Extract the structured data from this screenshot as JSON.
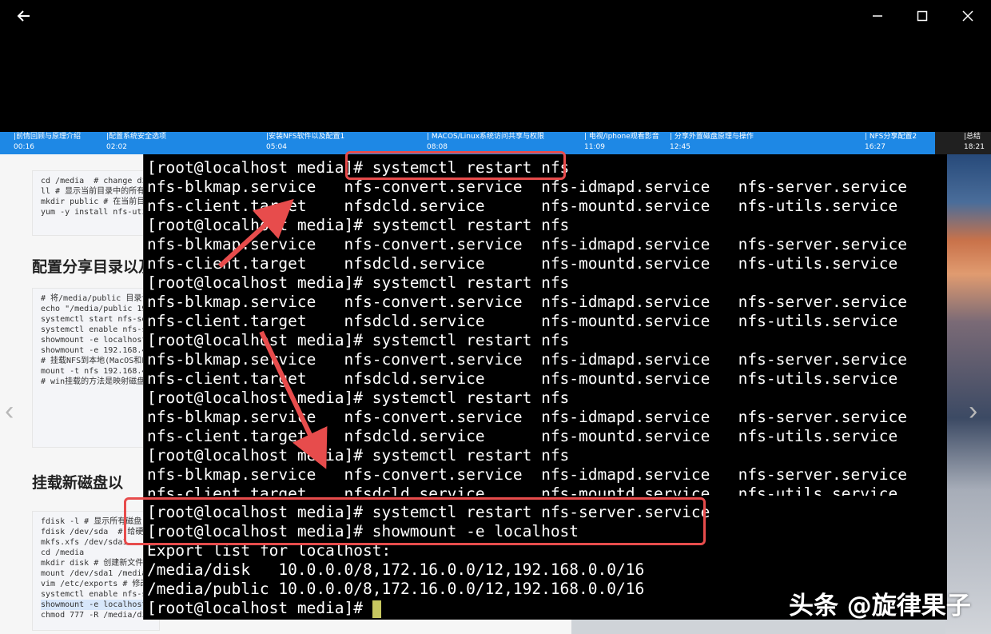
{
  "window": {
    "back_icon": "arrow-left-icon",
    "minimize_icon": "minimize-icon",
    "maximize_icon": "maximize-icon",
    "close_icon": "close-icon"
  },
  "chapters": [
    {
      "title": "|前情回顾与原理介绍",
      "time": "00:16"
    },
    {
      "title": "|配置系统安全选项",
      "time": "02:02"
    },
    {
      "title": "|安装NFS软件以及配置1",
      "time": "05:04"
    },
    {
      "title": "| MACOS/Linux系统访问共享与权限",
      "time": "08:08"
    },
    {
      "title": "| 电视/Iphone观看影音",
      "time": "11:09"
    },
    {
      "title": "| 分享外置磁盘原理与操作",
      "time": "12:45"
    },
    {
      "title": "| NFS分享配置2",
      "time": "16:27"
    },
    {
      "title": "|总结",
      "time": "18:21"
    }
  ],
  "doc": {
    "code1": [
      "cd /media  # change di",
      "ll # 显示当前目录中的所有文",
      "mkdir public # 在当前目",
      "",
      "yum -y install nfs-uti"
    ],
    "heading1": "配置分享目录以及",
    "code2": [
      "# 将/media/public 目录设",
      "echo \"/media/public 19",
      "",
      "systemctl start nfs-se",
      "systemctl enable nfs-s",
      "",
      "showmount -e localhost",
      "showmount -e 192.168.4",
      "",
      "# 挂载NFS到本地(MacOS和L",
      "mount -t nfs 192.168.4",
      "",
      "# win挂载的方法是映射磁盘"
    ],
    "heading2": "挂载新磁盘以",
    "code3": [
      "fdisk -l # 显示所有磁盘",
      "fdisk /dev/sda  # 给硬盘",
      "mkfs.xfs /dev/sda1",
      "cd /media",
      "mkdir disk # 创建新文件",
      "mount /dev/sda1 /media",
      "vim /etc/exports # 修改",
      "systemctl enable nfs-s",
      "showmount -e localhost",
      "chmod 777 -R /media/di"
    ]
  },
  "nav": {
    "prev": "‹",
    "next": "›"
  },
  "terminal": {
    "lines": [
      "[root@localhost media]# systemctl restart nfs",
      "nfs-blkmap.service   nfs-convert.service  nfs-idmapd.service   nfs-server.service",
      "nfs-client.target    nfsdcld.service      nfs-mountd.service   nfs-utils.service",
      "[root@localhost media]# systemctl restart nfs",
      "nfs-blkmap.service   nfs-convert.service  nfs-idmapd.service   nfs-server.service",
      "nfs-client.target    nfsdcld.service      nfs-mountd.service   nfs-utils.service",
      "[root@localhost media]# systemctl restart nfs",
      "nfs-blkmap.service   nfs-convert.service  nfs-idmapd.service   nfs-server.service",
      "nfs-client.target    nfsdcld.service      nfs-mountd.service   nfs-utils.service",
      "[root@localhost media]# systemctl restart nfs",
      "nfs-blkmap.service   nfs-convert.service  nfs-idmapd.service   nfs-server.service",
      "nfs-client.target    nfsdcld.service      nfs-mountd.service   nfs-utils.service",
      "[root@localhost media]# systemctl restart nfs",
      "nfs-blkmap.service   nfs-convert.service  nfs-idmapd.service   nfs-server.service",
      "nfs-client.target    nfsdcld.service      nfs-mountd.service   nfs-utils.service",
      "[root@localhost media]# systemctl restart nfs",
      "nfs-blkmap.service   nfs-convert.service  nfs-idmapd.service   nfs-server.service",
      "nfs-client.target    nfsdcld.service      nfs-mountd.service   nfs-utils.service",
      "[root@localhost media]# systemctl restart nfs-server.service",
      "[root@localhost media]# showmount -e localhost",
      "Export list for localhost:",
      "/media/disk   10.0.0.0/8,172.16.0.0/12,192.168.0.0/16",
      "/media/public 10.0.0.0/8,172.16.0.0/12,192.168.0.0/16"
    ],
    "prompt": "[root@localhost media]# "
  },
  "watermark": "头条 @旋律果子",
  "colors": {
    "highlight": "#e74c4c",
    "chapter_bar": "#1e88e5",
    "cursor": "#c7c760"
  }
}
